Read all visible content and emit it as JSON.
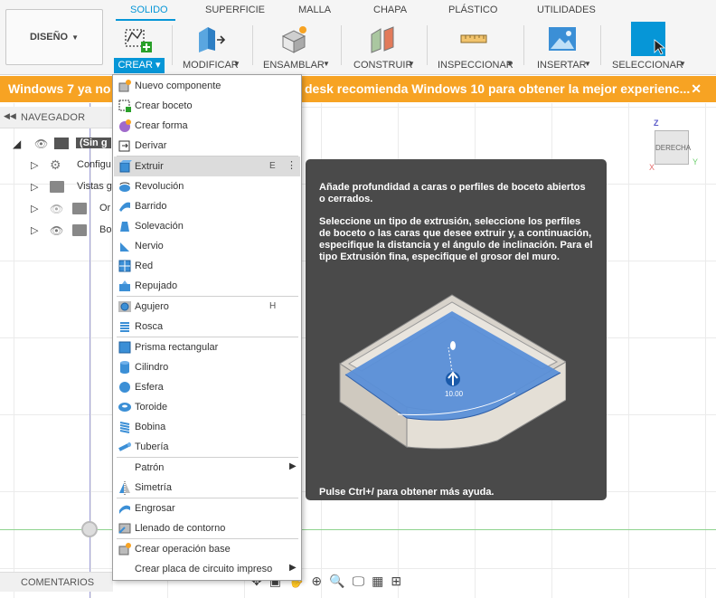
{
  "toolbar": {
    "design_label": "DISEÑO",
    "tabs": [
      "SOLIDO",
      "SUPERFICIE",
      "MALLA",
      "CHAPA",
      "PLÁSTICO",
      "UTILIDADES"
    ],
    "groups": {
      "crear": "CREAR",
      "modificar": "MODIFICAR",
      "ensamblar": "ENSAMBLAR",
      "construir": "CONSTRUIR",
      "inspeccionar": "INSPECCIONAR",
      "insertar": "INSERTAR",
      "seleccionar": "SELECCIONAR"
    }
  },
  "banner": {
    "left_text": "Windows 7 ya no",
    "right_text": "desk recomienda Windows 10 para obtener la mejor experienc...",
    "close": "✕"
  },
  "navigator": {
    "title": "NAVEGADOR",
    "root_label": "(Sin g",
    "items": [
      "Configu",
      "Vistas g",
      "Or",
      "Bo"
    ]
  },
  "viewcube": {
    "face": "DERECHA",
    "z": "Z",
    "y": "Y",
    "x": "X"
  },
  "comments": {
    "title": "COMENTARIOS"
  },
  "menu": {
    "items": [
      {
        "label": "Nuevo componente",
        "icon": "new-component-icon"
      },
      {
        "label": "Crear boceto",
        "icon": "sketch-icon"
      },
      {
        "label": "Crear forma",
        "icon": "form-icon"
      },
      {
        "label": "Derivar",
        "icon": "derive-icon"
      },
      {
        "label": "Extruir",
        "icon": "extrude-icon",
        "shortcut": "E",
        "highlighted": true
      },
      {
        "label": "Revolución",
        "icon": "revolve-icon"
      },
      {
        "label": "Barrido",
        "icon": "sweep-icon"
      },
      {
        "label": "Solevación",
        "icon": "loft-icon"
      },
      {
        "label": "Nervio",
        "icon": "rib-icon"
      },
      {
        "label": "Red",
        "icon": "web-icon"
      },
      {
        "label": "Repujado",
        "icon": "emboss-icon"
      },
      {
        "label": "Agujero",
        "icon": "hole-icon",
        "shortcut": "H"
      },
      {
        "label": "Rosca",
        "icon": "thread-icon"
      },
      {
        "label": "Prisma rectangular",
        "icon": "box-icon"
      },
      {
        "label": "Cilindro",
        "icon": "cylinder-icon"
      },
      {
        "label": "Esfera",
        "icon": "sphere-icon"
      },
      {
        "label": "Toroide",
        "icon": "torus-icon"
      },
      {
        "label": "Bobina",
        "icon": "coil-icon"
      },
      {
        "label": "Tubería",
        "icon": "pipe-icon"
      },
      {
        "label": "Patrón",
        "icon": "",
        "submenu": true
      },
      {
        "label": "Simetría",
        "icon": "mirror-icon"
      },
      {
        "label": "Engrosar",
        "icon": "thicken-icon"
      },
      {
        "label": "Llenado de contorno",
        "icon": "boundary-fill-icon"
      },
      {
        "label": "Crear operación base",
        "icon": "base-feature-icon"
      },
      {
        "label": "Crear placa de circuito impreso",
        "icon": "",
        "submenu": true
      }
    ]
  },
  "tooltip": {
    "heading": "Añade profundidad a caras o perfiles de boceto abiertos o cerrados.",
    "body": "Seleccione un tipo de extrusión, seleccione los perfiles de boceto o las caras que desee extruir y, a continuación, especifique la distancia y el ángulo de inclinación. Para el tipo Extrusión fina, especifique el grosor del muro.",
    "dimension": "10.00",
    "footer": "Pulse Ctrl+/ para obtener más ayuda."
  },
  "colors": {
    "accent": "#0696d7",
    "banner": "#f7a323",
    "tooltip_bg": "#4a4a4a",
    "highlight": "#dcdcdc"
  }
}
